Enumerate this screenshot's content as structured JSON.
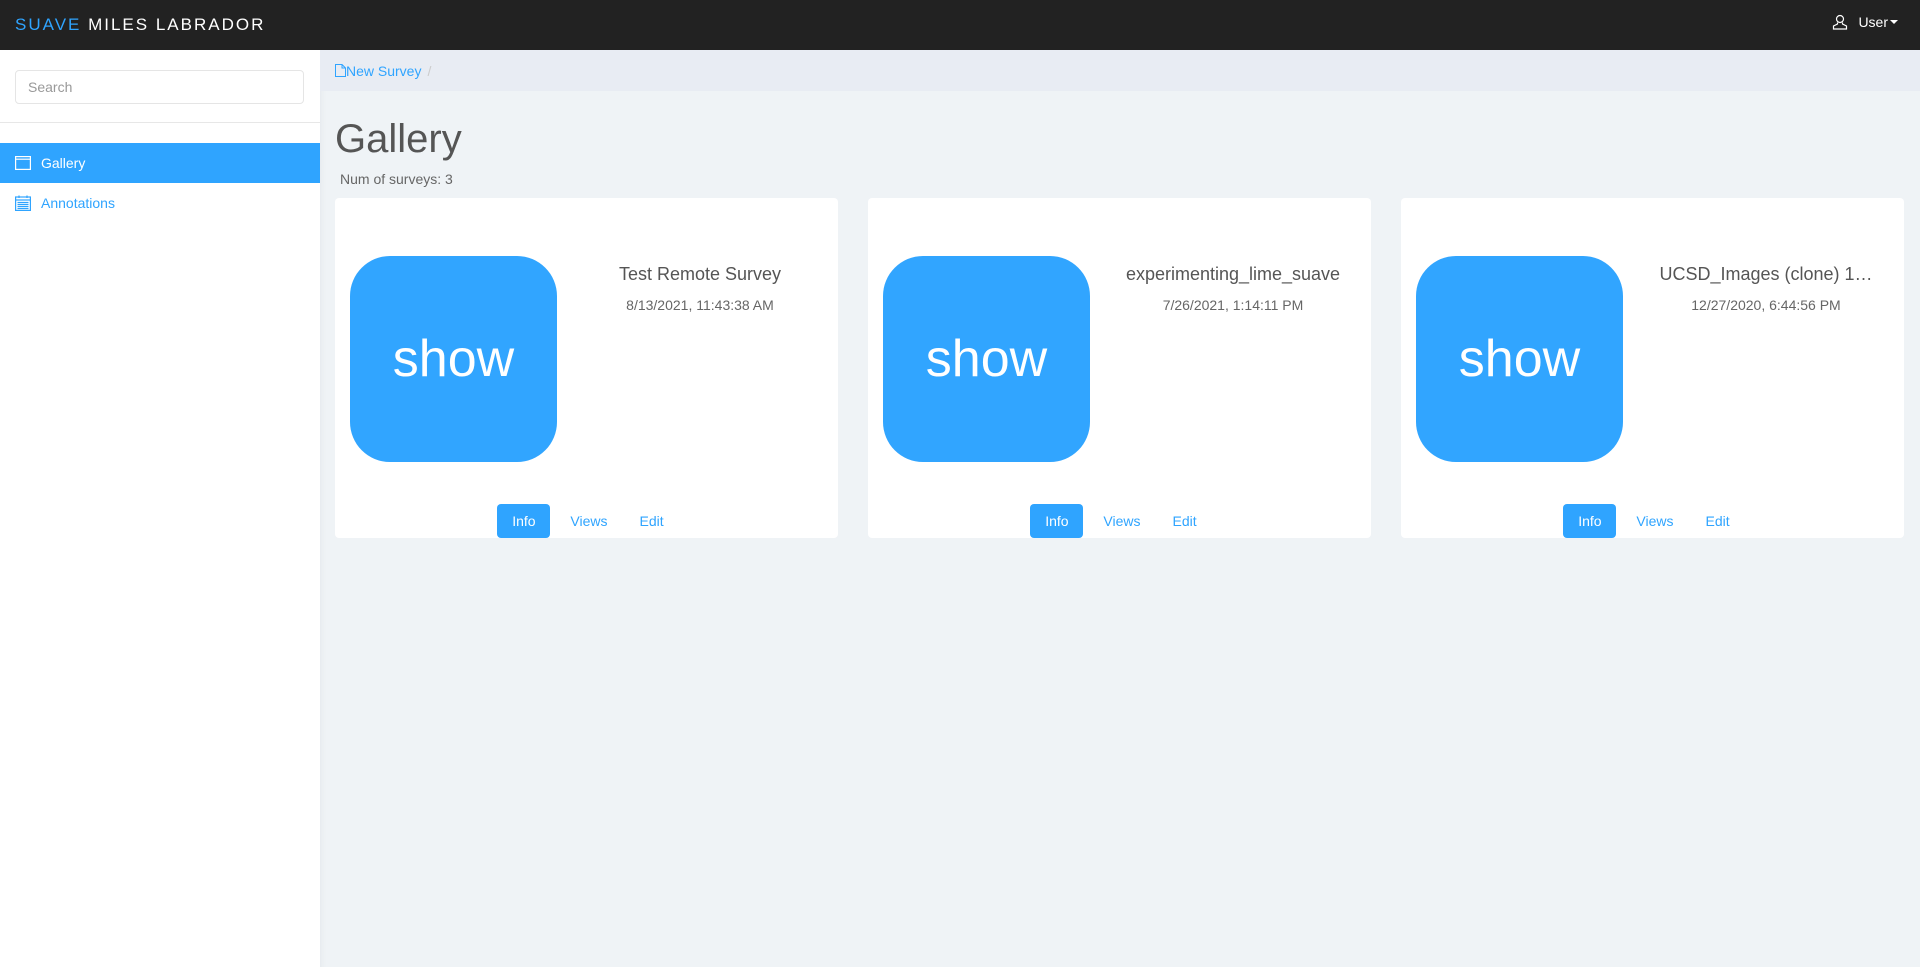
{
  "navbar": {
    "brand_accent": "SUAVE",
    "brand_rest": " MILES LABRADOR",
    "user_label": "User",
    "user_icon": "user-icon"
  },
  "sidebar": {
    "search_placeholder": "Search",
    "items": [
      {
        "label": "Gallery",
        "icon": "window-icon",
        "active": true
      },
      {
        "label": "Annotations",
        "icon": "calendar-icon",
        "active": false
      }
    ]
  },
  "breadcrumb": {
    "new_survey": "New Survey",
    "separator": "/"
  },
  "main": {
    "title": "Gallery",
    "count_text": "Num of surveys: 3",
    "cards": [
      {
        "tile": "show",
        "title": "Test Remote Survey",
        "date": "8/13/2021, 11:43:38 AM",
        "info": "Info",
        "views": "Views",
        "edit": "Edit"
      },
      {
        "tile": "show",
        "title": "experimenting_lime_suave",
        "date": "7/26/2021, 1:14:11 PM",
        "info": "Info",
        "views": "Views",
        "edit": "Edit"
      },
      {
        "tile": "show",
        "title": "UCSD_Images (clone) 1…",
        "date": "12/27/2020, 6:44:56 PM",
        "info": "Info",
        "views": "Views",
        "edit": "Edit"
      }
    ]
  },
  "colors": {
    "accent": "#2fa4ff",
    "navbar_bg": "#222222",
    "page_bg": "#eff3f6"
  }
}
